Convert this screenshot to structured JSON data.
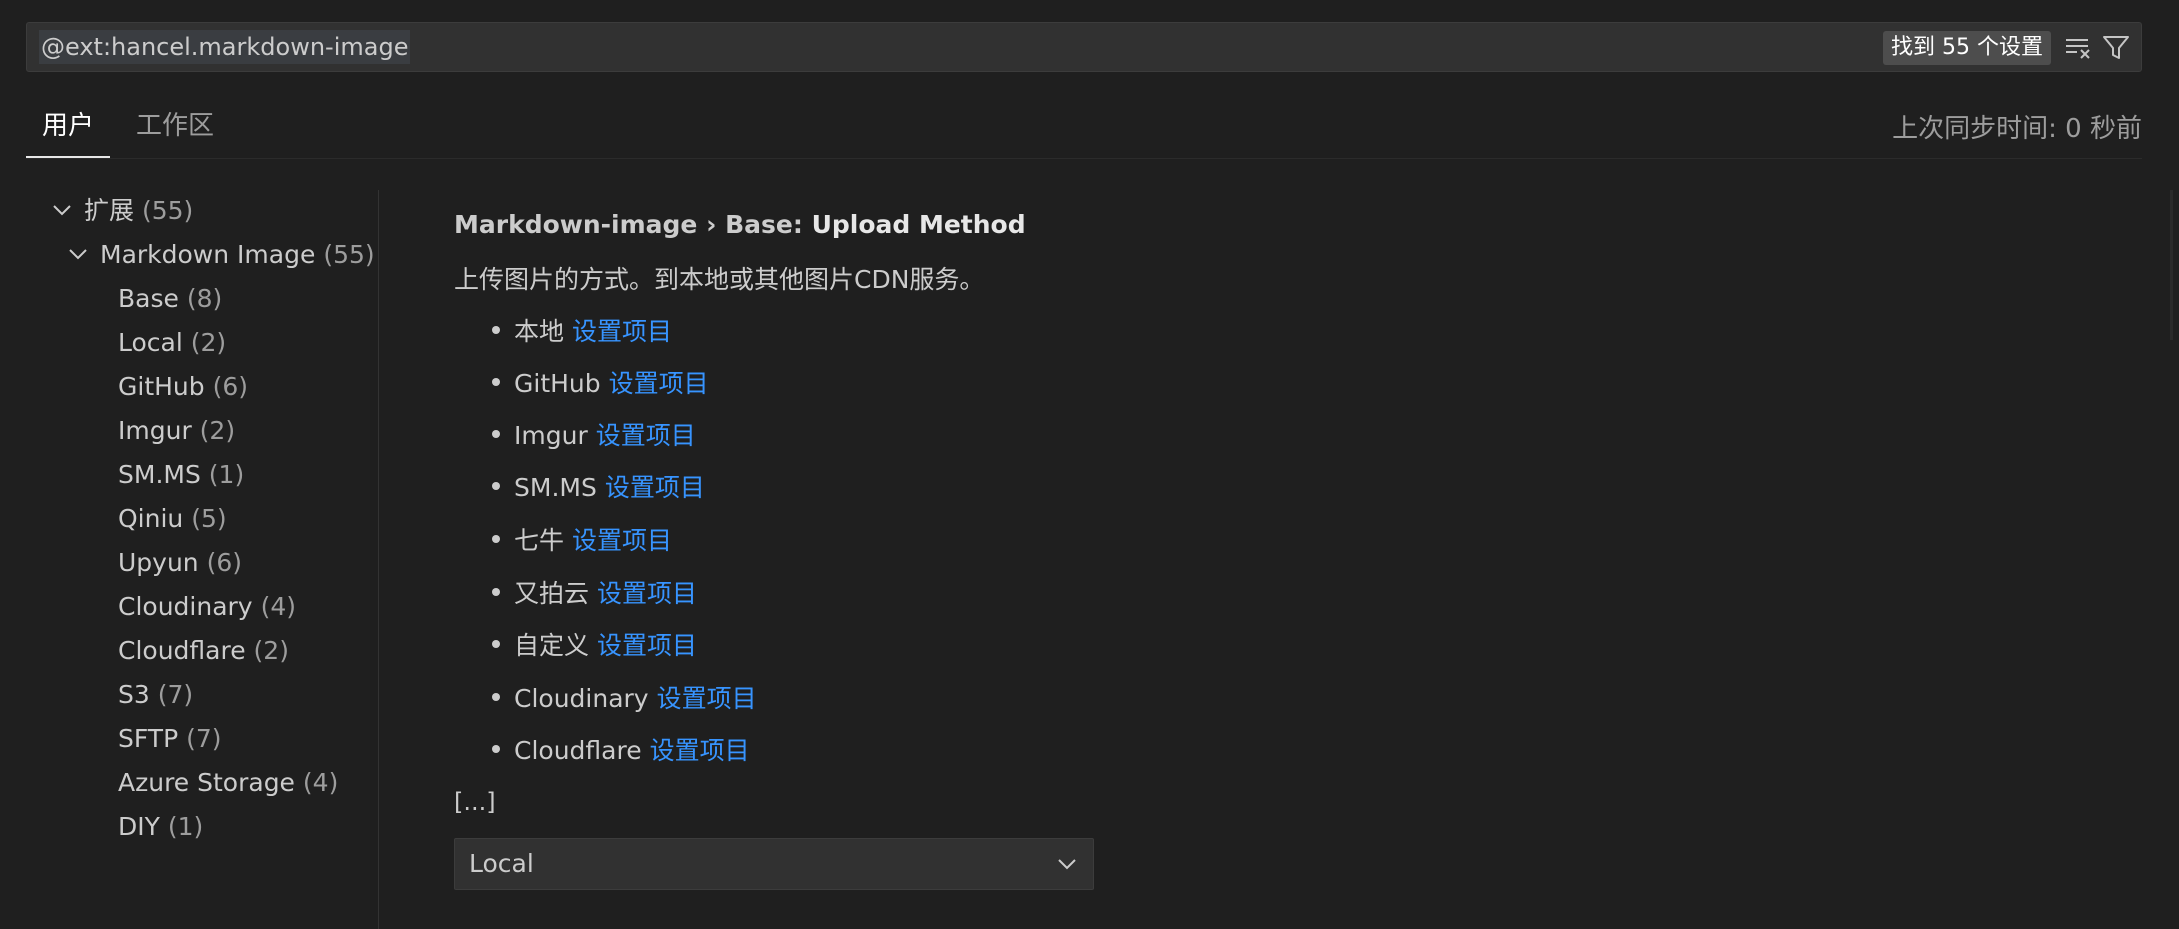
{
  "search": {
    "query": "@ext:hancel.markdown-image",
    "count": "找到 55 个设置"
  },
  "tabs": [
    {
      "label": "用户"
    },
    {
      "label": "工作区"
    }
  ],
  "last_sync": "上次同步时间: 0 秒前",
  "toc": {
    "extensions": {
      "label": "扩展",
      "count": "(55)"
    },
    "markdown_image": {
      "label": "Markdown Image",
      "count": "(55)"
    },
    "items": [
      {
        "label": "Base",
        "count": "(8)"
      },
      {
        "label": "Local",
        "count": "(2)"
      },
      {
        "label": "GitHub",
        "count": "(6)"
      },
      {
        "label": "Imgur",
        "count": "(2)"
      },
      {
        "label": "SM.MS",
        "count": "(1)"
      },
      {
        "label": "Qiniu",
        "count": "(5)"
      },
      {
        "label": "Upyun",
        "count": "(6)"
      },
      {
        "label": "Cloudinary",
        "count": "(4)"
      },
      {
        "label": "Cloudflare",
        "count": "(2)"
      },
      {
        "label": "S3",
        "count": "(7)"
      },
      {
        "label": "SFTP",
        "count": "(7)"
      },
      {
        "label": "Azure Storage",
        "count": "(4)"
      },
      {
        "label": "DIY",
        "count": "(1)"
      }
    ]
  },
  "setting": {
    "category": "Markdown-image › Base: ",
    "key": "Upload Method",
    "description": "上传图片的方式。到本地或其他图片CDN服务。",
    "options": [
      {
        "name": "本地",
        "link": "设置项目"
      },
      {
        "name": "GitHub",
        "link": "设置项目"
      },
      {
        "name": "Imgur",
        "link": "设置项目"
      },
      {
        "name": "SM.MS",
        "link": "设置项目"
      },
      {
        "name": "七牛",
        "link": "设置项目"
      },
      {
        "name": "又拍云",
        "link": "设置项目"
      },
      {
        "name": "自定义",
        "link": "设置项目"
      },
      {
        "name": "Cloudinary",
        "link": "设置项目"
      },
      {
        "name": "Cloudflare",
        "link": "设置项目"
      }
    ],
    "truncated": "[...]",
    "value": "Local"
  },
  "icons": {
    "clear": "clear-filter-icon",
    "filter": "filter-icon",
    "chevron": "chevron-down-icon"
  }
}
